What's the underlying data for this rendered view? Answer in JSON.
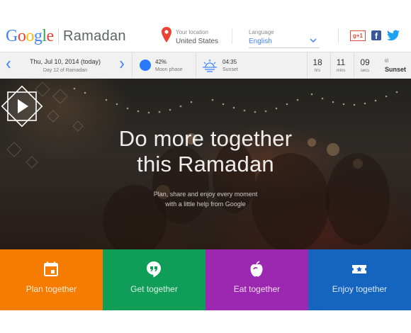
{
  "header": {
    "logo_letters": [
      "G",
      "o",
      "o",
      "g",
      "l",
      "e"
    ],
    "logo_colors": [
      "#4285f4",
      "#ea4335",
      "#fbbc05",
      "#4285f4",
      "#34a853",
      "#ea4335"
    ],
    "brand": "Ramadan",
    "location_label": "Your location",
    "location_value": "United States",
    "language_label": "Language",
    "language_value": "English",
    "gplus_label": "g+1",
    "facebook_label": "f"
  },
  "infobar": {
    "date": "Thu, Jul 10, 2014 (today)",
    "day_of": "Day 12 of Ramadan",
    "moon_percent": "42%",
    "moon_label": "Moon phase",
    "sunset_time": "04:35",
    "sunset_label": "Sunset",
    "countdown": [
      {
        "value": "18",
        "unit": "hrs"
      },
      {
        "value": "11",
        "unit": "mins"
      },
      {
        "value": "09",
        "unit": "secs"
      }
    ],
    "til_label": "til",
    "til_value": "Sunset"
  },
  "hero": {
    "title_line1": "Do more together",
    "title_line2": "this Ramadan",
    "subtitle_line1": "Plan, share and enjoy every moment",
    "subtitle_line2": "with a little help from Google"
  },
  "tiles": [
    {
      "label": "Plan together",
      "icon": "calendar-icon",
      "color": "#f57c00"
    },
    {
      "label": "Get together",
      "icon": "hangouts-icon",
      "color": "#0f9d58"
    },
    {
      "label": "Eat together",
      "icon": "apple-icon",
      "color": "#9c27b0"
    },
    {
      "label": "Enjoy together",
      "icon": "ticket-icon",
      "color": "#1565c0"
    }
  ],
  "colors": {
    "accent_blue": "#4285f4",
    "moon_blue": "#2979ff"
  }
}
